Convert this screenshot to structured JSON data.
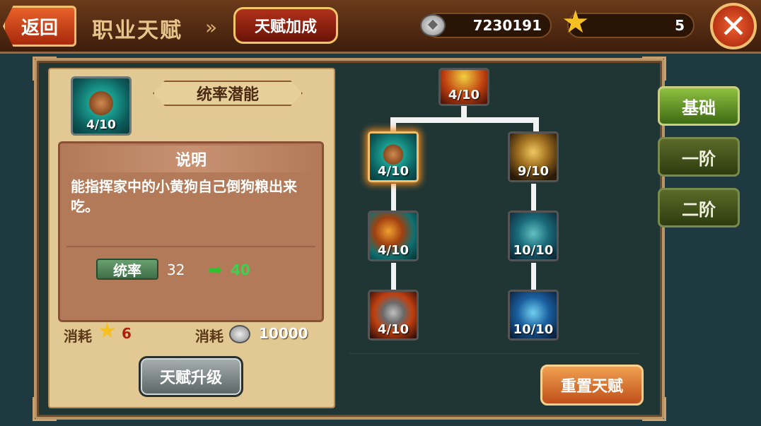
{
  "header": {
    "back_label": "返回",
    "page_title": "职业天赋",
    "breadcrumb_separator": "»",
    "subtitle": "天赋加成",
    "silver_amount": "7230191",
    "star_amount": "5"
  },
  "selected_talent": {
    "name": "统率潜能",
    "level": "4/10",
    "description_title": "说明",
    "description": "能指挥家中的小黄狗自己倒狗粮出来吃。",
    "stat_name": "统率",
    "stat_current": "32",
    "stat_next": "40",
    "cost_label": "消耗",
    "cost_star": "6",
    "cost_silver": "10000",
    "upgrade_label": "天赋升级"
  },
  "tree": {
    "nodes": [
      {
        "id": "top",
        "level": "4/10",
        "icon": "sun-fist-icon"
      },
      {
        "id": "left-1",
        "level": "4/10",
        "icon": "fist-gear-icon",
        "selected": true
      },
      {
        "id": "right-1",
        "level": "9/10",
        "icon": "golden-warrior-icon"
      },
      {
        "id": "left-2",
        "level": "4/10",
        "icon": "flame-wave-icon"
      },
      {
        "id": "right-2",
        "level": "10/10",
        "icon": "swordsman-icon"
      },
      {
        "id": "left-3",
        "level": "4/10",
        "icon": "shield-icon"
      },
      {
        "id": "right-3",
        "level": "10/10",
        "icon": "blue-knight-icon"
      }
    ],
    "reset_label": "重置天赋"
  },
  "tabs": [
    {
      "label": "基础",
      "active": true
    },
    {
      "label": "一阶",
      "active": false
    },
    {
      "label": "二阶",
      "active": false
    }
  ]
}
